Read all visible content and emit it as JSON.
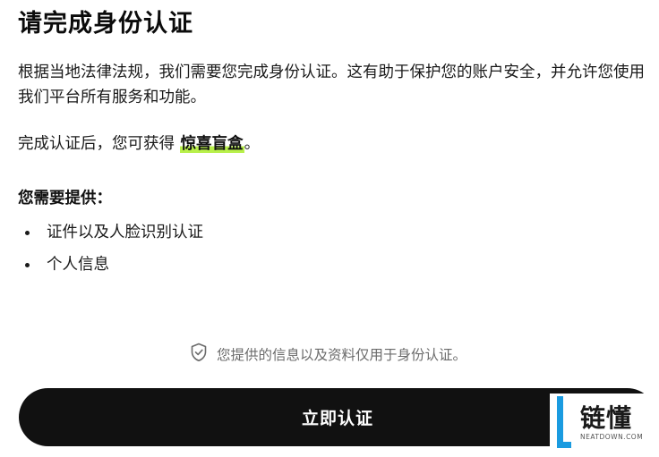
{
  "title": "请完成身份认证",
  "intro": "根据当地法律法规，我们需要您完成身份认证。这有助于保护您的账户安全，并允许您使用我们平台所有服务和功能。",
  "reward": {
    "prefix": "完成认证后，您可获得 ",
    "highlight": "惊喜盲盒",
    "suffix": "。"
  },
  "requirements": {
    "heading": "您需要提供：",
    "items": [
      "证件以及人脸识别认证",
      "个人信息"
    ]
  },
  "privacy_note": "您提供的信息以及资料仅用于身份认证。",
  "verify_button": "立即认证",
  "watermark": {
    "main": "链懂",
    "sub": "NEATDOWN.COM",
    "color": "#1a9be0"
  },
  "colors": {
    "accent_highlight": "#b8f04a",
    "button_bg": "#111111"
  }
}
